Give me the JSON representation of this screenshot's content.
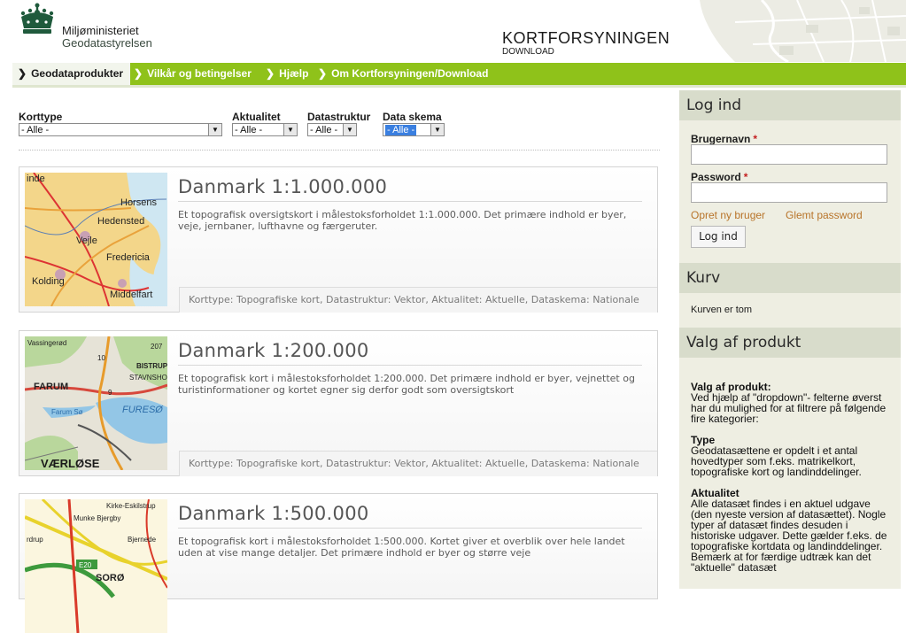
{
  "header": {
    "ministry": "Miljøministeriet",
    "agency": "Geodatastyrelsen",
    "brand": "KORTFORSYNINGEN",
    "brand_sub": "DOWNLOAD"
  },
  "nav": {
    "items": [
      {
        "label": "Geodataprodukter",
        "active": true
      },
      {
        "label": "Vilkår og betingelser",
        "active": false
      },
      {
        "label": "Hjælp",
        "active": false
      },
      {
        "label": "Om Kortforsyningen/Download",
        "active": false
      }
    ],
    "chevron": "❯"
  },
  "filters": [
    {
      "label": "Korttype",
      "value": "- Alle -"
    },
    {
      "label": "Aktualitet",
      "value": "- Alle -"
    },
    {
      "label": "Datastruktur",
      "value": "- Alle -"
    },
    {
      "label": "Data skema",
      "value": "- Alle -"
    }
  ],
  "products": [
    {
      "title": "Danmark 1:1.000.000",
      "description": "Et topografisk oversigtskort i målestoksforholdet 1:1.000.000. Det primære indhold er byer, veje, jernbaner, lufthavne og færgeruter.",
      "meta": "Korttype: Topografiske kort, Datastruktur: Vektor, Aktualitet: Aktuelle, Dataskema: Nationale",
      "thumb_labels": [
        "inde",
        "Horsens",
        "Hedensted",
        "Vejle",
        "Fredericia",
        "Kolding",
        "Middelfart"
      ]
    },
    {
      "title": "Danmark 1:200.000",
      "description": "Et topografisk kort i målestoksforholdet 1:200.000. Det primære indhold er byer, vejnettet og turistinformationer og kortet egner sig derfor godt som oversigtskort",
      "meta": "Korttype: Topografiske kort, Datastruktur: Vektor, Aktualitet: Aktuelle, Dataskema: Nationale",
      "thumb_labels": [
        "Vassingerød",
        "FARUM",
        "BISTRUP",
        "STAVNSHOLT",
        "Farum Sø",
        "FURESØ",
        "VÆRLØSE",
        "10",
        "9",
        "207"
      ]
    },
    {
      "title": "Danmark 1:500.000",
      "description": "Et topografisk kort i målestoksforholdet 1:500.000. Kortet giver et overblik over hele landet uden at vise mange detaljer. Det primære indhold er byer og større veje",
      "meta": "",
      "thumb_labels": [
        "Kirke-Eskilstrup",
        "Munke Bjergby",
        "Bjernede",
        "E20",
        "SORØ",
        "rdrup"
      ]
    }
  ],
  "sidebar": {
    "login_title": "Log ind",
    "username_label": "Brugernavn",
    "password_label": "Password",
    "required_mark": "*",
    "new_user_link": "Opret ny bruger",
    "forgot_link": "Glemt password",
    "login_button": "Log ind",
    "basket_title": "Kurv",
    "basket_text": "Kurven er tom",
    "selection_title": "Valg af produkt",
    "help": {
      "intro_title": "Valg af produkt:",
      "intro_text": "Ved hjælp af \"dropdown\"- felterne øverst har du mulighed for at filtrere på følgende fire kategorier:",
      "type_title": "Type",
      "type_text": "Geodatasættene er opdelt i et antal hovedtyper som f.eks. matrikelkort, topografiske kort og landinddelinger.",
      "actual_title": "Aktualitet",
      "actual_text": "Alle datasæt findes i en aktuel udgave (den nyeste version af datasættet). Nogle typer af datasæt findes desuden i historiske udgaver. Dette gælder f.eks. de topografiske kortdata og landinddelinger. Bemærk at for færdige udtræk kan det \"aktuelle\" datasæt"
    }
  },
  "colors": {
    "nav_green": "#8fc21a",
    "crown_green": "#1f5a3c",
    "link_orange": "#b8742a",
    "sidebar_bg": "#eeeee2",
    "sidebar_head": "#d8dccb"
  },
  "icons": {
    "logo": "crown-icon",
    "chevron": "chevron-right-icon",
    "dropdown": "triangle-down-icon"
  }
}
